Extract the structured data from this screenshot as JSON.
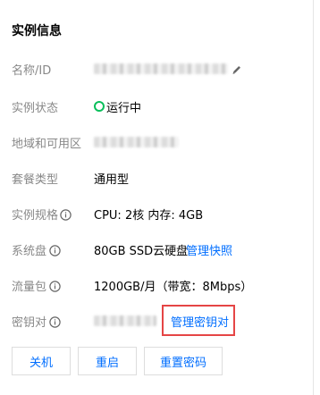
{
  "section": {
    "title": "实例信息"
  },
  "rows": {
    "name": {
      "label": "名称/ID"
    },
    "status": {
      "label": "实例状态",
      "value": "运行中"
    },
    "region": {
      "label": "地域和可用区"
    },
    "package": {
      "label": "套餐类型",
      "value": "通用型"
    },
    "spec": {
      "label": "实例规格",
      "value": "CPU: 2核 内存: 4GB"
    },
    "disk": {
      "label": "系统盘",
      "value": "80GB SSD云硬盘",
      "link": "管理快照"
    },
    "traffic": {
      "label": "流量包",
      "value": "1200GB/月（带宽：8Mbps）"
    },
    "keypair": {
      "label": "密钥对",
      "link": "管理密钥对"
    }
  },
  "actions": {
    "shutdown": "关机",
    "restart": "重启",
    "reset_password": "重置密码"
  },
  "colors": {
    "accent": "#006eff",
    "status_green": "#0abf5b",
    "highlight_red": "#e54545",
    "label_gray": "#888888"
  },
  "icons": {
    "edit": "pencil-icon",
    "info": "info-circle-icon",
    "status": "status-ring-icon"
  }
}
